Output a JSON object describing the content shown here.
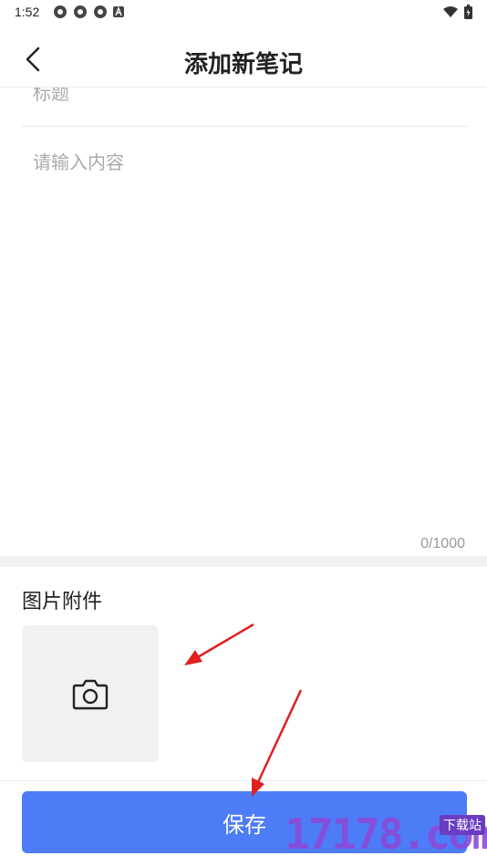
{
  "status_bar": {
    "time": "1:52"
  },
  "header": {
    "title": "添加新笔记"
  },
  "form": {
    "title_placeholder": "标题",
    "content_placeholder": "请输入内容",
    "counter": "0/1000"
  },
  "attachments": {
    "label": "图片附件"
  },
  "save_button": {
    "label": "保存"
  },
  "watermark": {
    "logo_text": "17178.com",
    "badge": "下载站"
  },
  "colors": {
    "primary": "#4c7cf6",
    "annotation_arrow": "#e02020"
  }
}
